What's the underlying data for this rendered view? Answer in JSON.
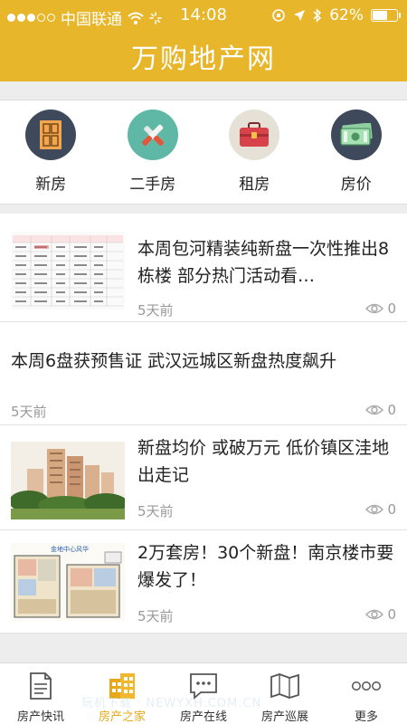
{
  "status_bar": {
    "carrier": "中国联通",
    "time": "14:08",
    "battery": "62%",
    "battery_level": 0.62
  },
  "header": {
    "title": "万购地产网"
  },
  "categories": [
    {
      "label": "新房",
      "icon": "door-icon",
      "color": "#3e4a5c"
    },
    {
      "label": "二手房",
      "icon": "tools-icon",
      "color": "#5fb8a6"
    },
    {
      "label": "租房",
      "icon": "toolbox-icon",
      "color": "#e6e1d6"
    },
    {
      "label": "房价",
      "icon": "cash-icon",
      "color": "#3e4a5c"
    }
  ],
  "news": [
    {
      "title": "本周包河精装纯新盘一次性推出8栋楼 部分热门活动看…",
      "time": "5天前",
      "views": "0",
      "thumb": "table-thumbnail"
    },
    {
      "title": "本周6盘获预售证 武汉远城区新盘热度飙升",
      "time": "5天前",
      "views": "0"
    },
    {
      "title": "新盘均价 或破万元 低价镇区洼地出走记",
      "time": "5天前",
      "views": "0",
      "thumb": "buildings-thumbnail"
    },
    {
      "title": "2万套房！30个新盘！南京楼市要爆发了！",
      "time": "5天前",
      "views": "0",
      "thumb": "floorplan-thumbnail"
    }
  ],
  "tabs": [
    {
      "label": "房产快讯",
      "icon": "document-icon"
    },
    {
      "label": "房产之家",
      "icon": "building-icon",
      "active": true
    },
    {
      "label": "房产在线",
      "icon": "chat-icon"
    },
    {
      "label": "房产巡展",
      "icon": "map-icon"
    },
    {
      "label": "更多",
      "icon": "more-icon"
    }
  ],
  "watermark": "玩机下载 · NEWYXH.COM.CN",
  "thumb_caption": "金地中心风华"
}
